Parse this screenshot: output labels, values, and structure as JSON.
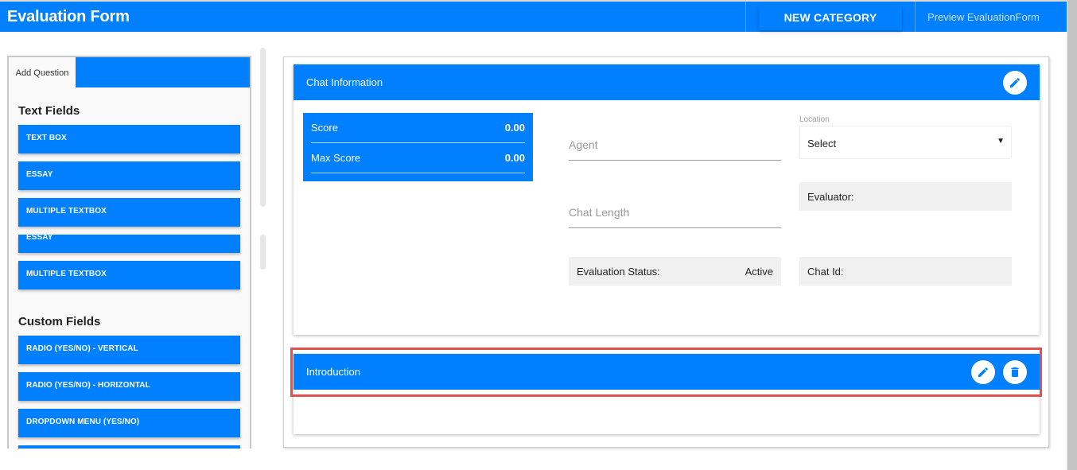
{
  "header": {
    "title": "Evaluation Form",
    "new_category_label": "NEW CATEGORY",
    "preview_label": "Preview EvaluationForm"
  },
  "sidebar": {
    "tabs": [
      {
        "label": "Add Question",
        "active": true
      }
    ],
    "sections": [
      {
        "title": "Text Fields",
        "items": [
          "TEXT BOX",
          "ESSAY",
          "MULTIPLE TEXTBOX",
          "ESSAY",
          "MULTIPLE TEXTBOX"
        ]
      },
      {
        "title": "Custom Fields",
        "items": [
          "RADIO (YES/NO) - VERTICAL",
          "RADIO (YES/NO) - HORIZONTAL",
          "DROPDOWN MENU (YES/NO)",
          ""
        ]
      }
    ]
  },
  "form": {
    "chat_info": {
      "title": "Chat Information",
      "score": {
        "label": "Score",
        "value": "0.00"
      },
      "max_score": {
        "label": "Max Score",
        "value": "0.00"
      },
      "agent_placeholder": "Agent",
      "chat_length_placeholder": "Chat Length",
      "location": {
        "label": "Location",
        "value": "Select",
        "arrow": "▼"
      },
      "evaluator": {
        "label": "Evaluator:",
        "value": ""
      },
      "evaluation_status": {
        "label": "Evaluation Status:",
        "value": "Active"
      },
      "chat_id": {
        "label": "Chat Id:",
        "value": ""
      }
    },
    "introduction": {
      "title": "Introduction"
    }
  },
  "colors": {
    "primary": "#0080ff",
    "highlight": "#e05050",
    "info_bg": "#f0f0f0"
  }
}
